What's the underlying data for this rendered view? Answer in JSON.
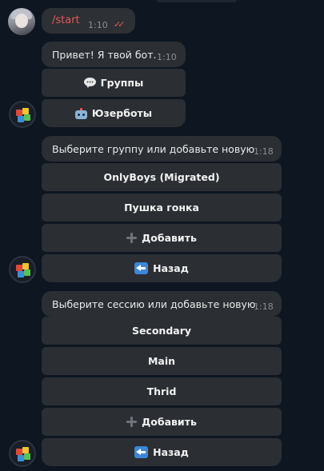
{
  "chat": {
    "user_message": {
      "text": "/start",
      "time": "1:10"
    },
    "bot_greeting": {
      "text": "Привет! Я твой бот.",
      "time": "1:10",
      "buttons": [
        {
          "icon": "speech-bubble-icon",
          "label": "Группы"
        },
        {
          "icon": "robot-icon",
          "label": "Юзерботы"
        }
      ]
    },
    "group_prompt": {
      "text": "Выберите группу или добавьте новую",
      "time": "1:18",
      "buttons": [
        {
          "label": "OnlyBoys (Migrated)"
        },
        {
          "label": "Пушка гонка"
        },
        {
          "icon": "plus-icon",
          "label": "Добавить"
        },
        {
          "icon": "back-arrow-icon",
          "label": "Назад"
        }
      ]
    },
    "session_prompt": {
      "text": "Выберите сессию или добавьте новую",
      "time": "1:18",
      "buttons": [
        {
          "label": "Secondary"
        },
        {
          "label": "Main"
        },
        {
          "label": "Thrid"
        },
        {
          "icon": "plus-icon",
          "label": "Добавить"
        },
        {
          "icon": "back-arrow-icon",
          "label": "Назад"
        }
      ]
    }
  },
  "colors": {
    "background": "#0e1621",
    "bubble": "#2b2e33",
    "command": "#e05a5a",
    "timestamp": "#8b8f96",
    "back_icon": "#3d86d6"
  }
}
